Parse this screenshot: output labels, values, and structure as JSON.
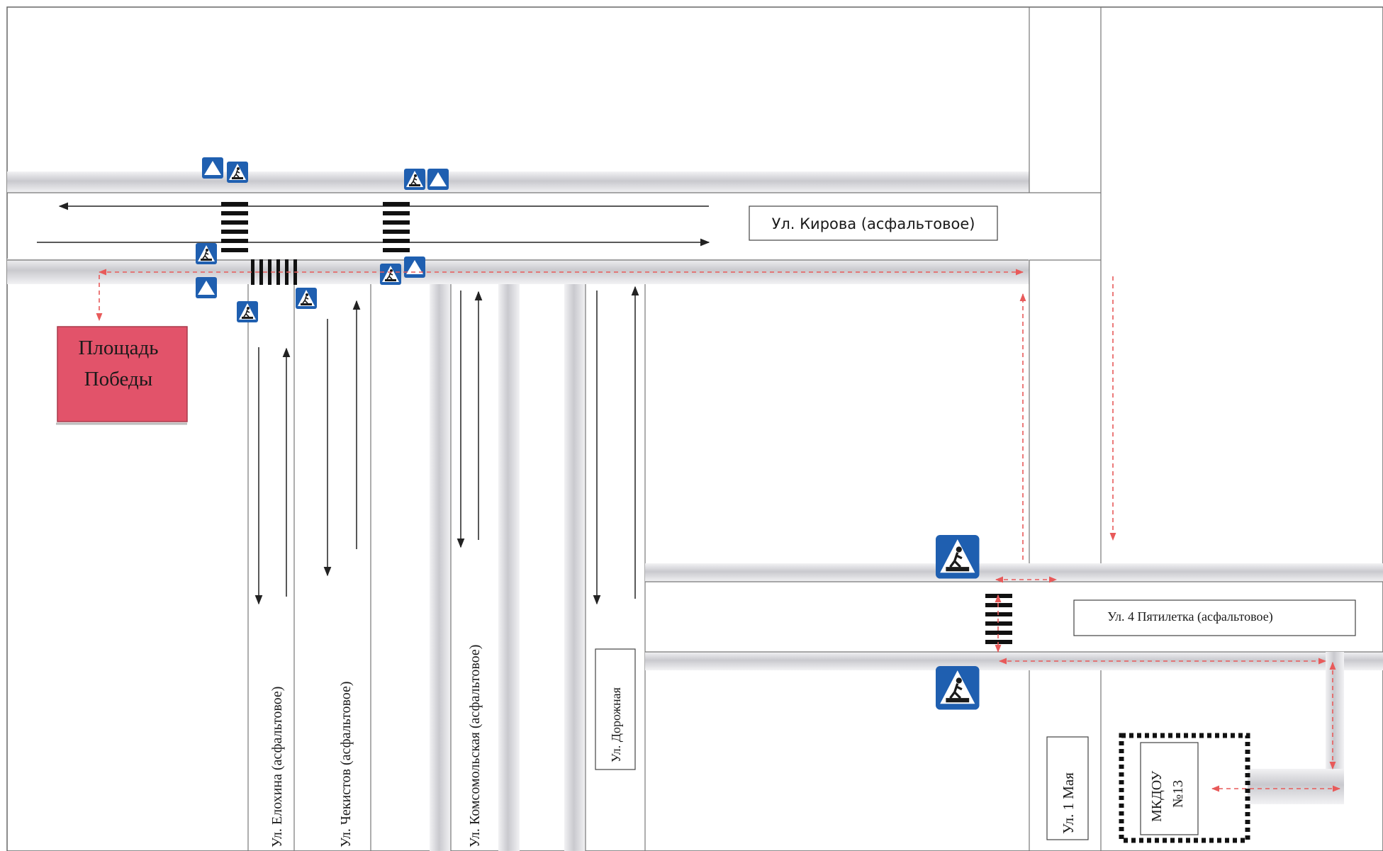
{
  "streets": {
    "kirova": "Ул. Кирова (асфальтовое)",
    "pyatiletka": "Ул. 4 Пятилетка (асфальтовое)",
    "elokhina": "Ул. Елохина (асфальтовое)",
    "chekistov": "Ул. Чекистов (асфальтовое)",
    "komsomolskaya": "Ул. Комсомольская (асфальтовое)",
    "dorozhnaya": "Ул. Дорожная",
    "maya": "Ул. 1 Мая"
  },
  "places": {
    "square_line1": "Площадь",
    "square_line2": "Победы",
    "kindergarten_line1": "МКДОУ",
    "kindergarten_line2": "№13"
  },
  "colors": {
    "square_fill": "#e2536a",
    "route": "#e85a5a",
    "sign_blue": "#1f5fb0",
    "road_border": "#777777"
  },
  "icons": [
    "pedestrian-crossing-sign-icon",
    "give-way-triangle-sign-icon",
    "direction-arrow-icon",
    "zebra-crossing-icon"
  ]
}
